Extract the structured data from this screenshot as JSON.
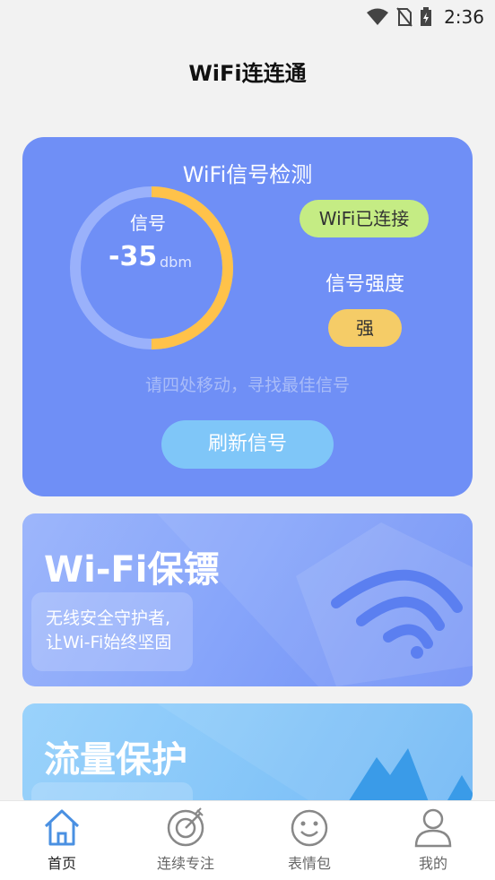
{
  "status_bar": {
    "time": "2:36"
  },
  "header": {
    "title": "WiFi连连通"
  },
  "signal_card": {
    "title": "WiFi信号检测",
    "gauge_label": "信号",
    "signal_value": "-35",
    "signal_unit": "dbm",
    "gauge_fill_fraction": 0.5,
    "connection_status": "WiFi已连接",
    "strength_label": "信号强度",
    "strength_value": "强",
    "hint": "请四处移动，寻找最佳信号",
    "refresh_button": "刷新信号"
  },
  "banners": {
    "wifi_guard": {
      "title": "Wi-Fi保镖",
      "desc_line1": "无线安全守护者,",
      "desc_line2": "让Wi-Fi始终坚固"
    },
    "traffic_protect": {
      "title": "流量保护"
    }
  },
  "tabbar": {
    "items": [
      {
        "label": "首页",
        "icon": "home-icon",
        "active": true
      },
      {
        "label": "连续专注",
        "icon": "focus-icon",
        "active": false
      },
      {
        "label": "表情包",
        "icon": "smiley-icon",
        "active": false
      },
      {
        "label": "我的",
        "icon": "profile-icon",
        "active": false
      }
    ]
  },
  "colors": {
    "card_blue": "#6f8ff6",
    "gauge_orange": "#ffc24a",
    "connected_green": "#c5ec84",
    "strength_yellow": "#f5cc67",
    "refresh_blue": "#7fc6f8",
    "tab_active": "#4a90e2"
  }
}
